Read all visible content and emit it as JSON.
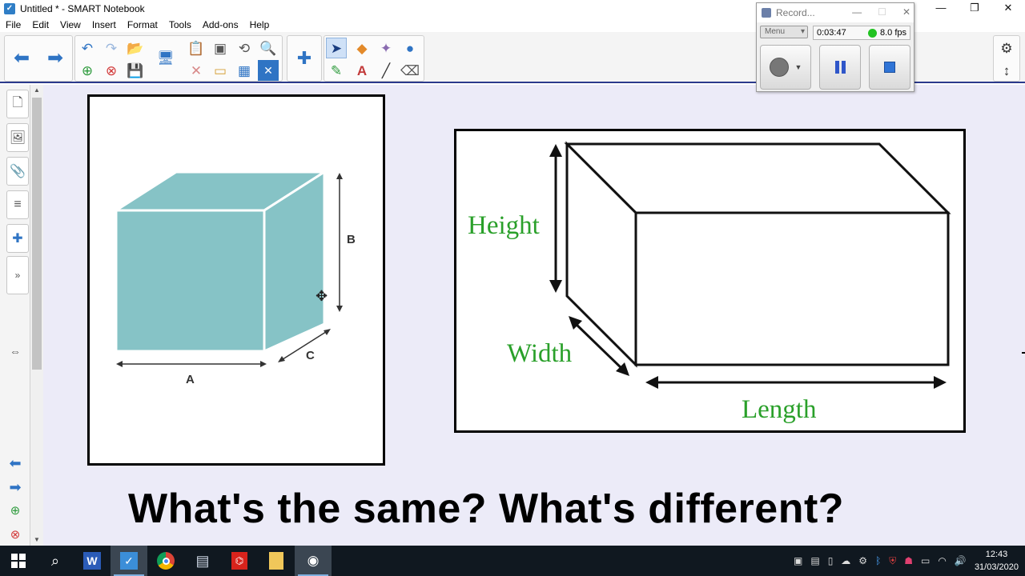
{
  "window": {
    "title": "Untitled * - SMART Notebook",
    "controls": [
      "—",
      "❐",
      "✕"
    ]
  },
  "menu": [
    "File",
    "Edit",
    "View",
    "Insert",
    "Format",
    "Tools",
    "Add-ons",
    "Help"
  ],
  "left_image": {
    "label_a": "A",
    "label_b": "B",
    "label_c": "C"
  },
  "right_image": {
    "label_height": "Height",
    "label_width": "Width",
    "label_length": "Length"
  },
  "question": "What's the same? What's different?",
  "recorder": {
    "title": "Record...",
    "menu_label": "Menu",
    "elapsed": "0:03:47",
    "fps": "8.0 fps",
    "status_color": "#22c322"
  },
  "taskbar": {
    "time": "12:43",
    "date": "31/03/2020"
  },
  "colors": {
    "cube_fill": "#86c3c6",
    "label_green": "#2aa02a",
    "canvas_bg": "#ecebf8",
    "toolbar_accent": "#2b3a8c"
  }
}
